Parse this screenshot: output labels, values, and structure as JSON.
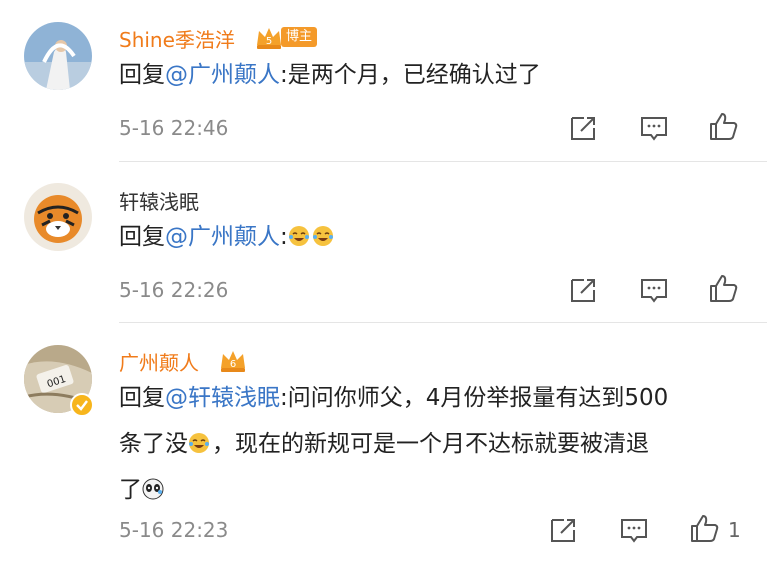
{
  "comments": [
    {
      "user": "Shine季浩洋",
      "tag": "博主",
      "reply_prefix": "回复",
      "mention": "@广州颠人",
      "text": ":是两个月，已经确认过了",
      "time": "5-16 22:46",
      "likes": ""
    },
    {
      "user": "轩辕浅眠",
      "reply_prefix": "回复",
      "mention": "@广州颠人",
      "text": ":",
      "time": "5-16 22:26",
      "likes": ""
    },
    {
      "user": "广州颠人",
      "reply_prefix": "回复",
      "mention": "@轩辕浅眠",
      "text1": ":问问你师父，4月份举报量有达到500",
      "text2": "条了没",
      "text3": "，现在的新规可是一个月不达标就要被清退",
      "text4": "了",
      "time": "5-16 22:23",
      "likes": "1"
    }
  ],
  "icons": [
    "share-icon",
    "comment-icon",
    "like-icon"
  ],
  "colors": {
    "name_orange": "#f07b1a",
    "mention_blue": "#3a76c6",
    "time_gray": "#8a8a8a"
  }
}
